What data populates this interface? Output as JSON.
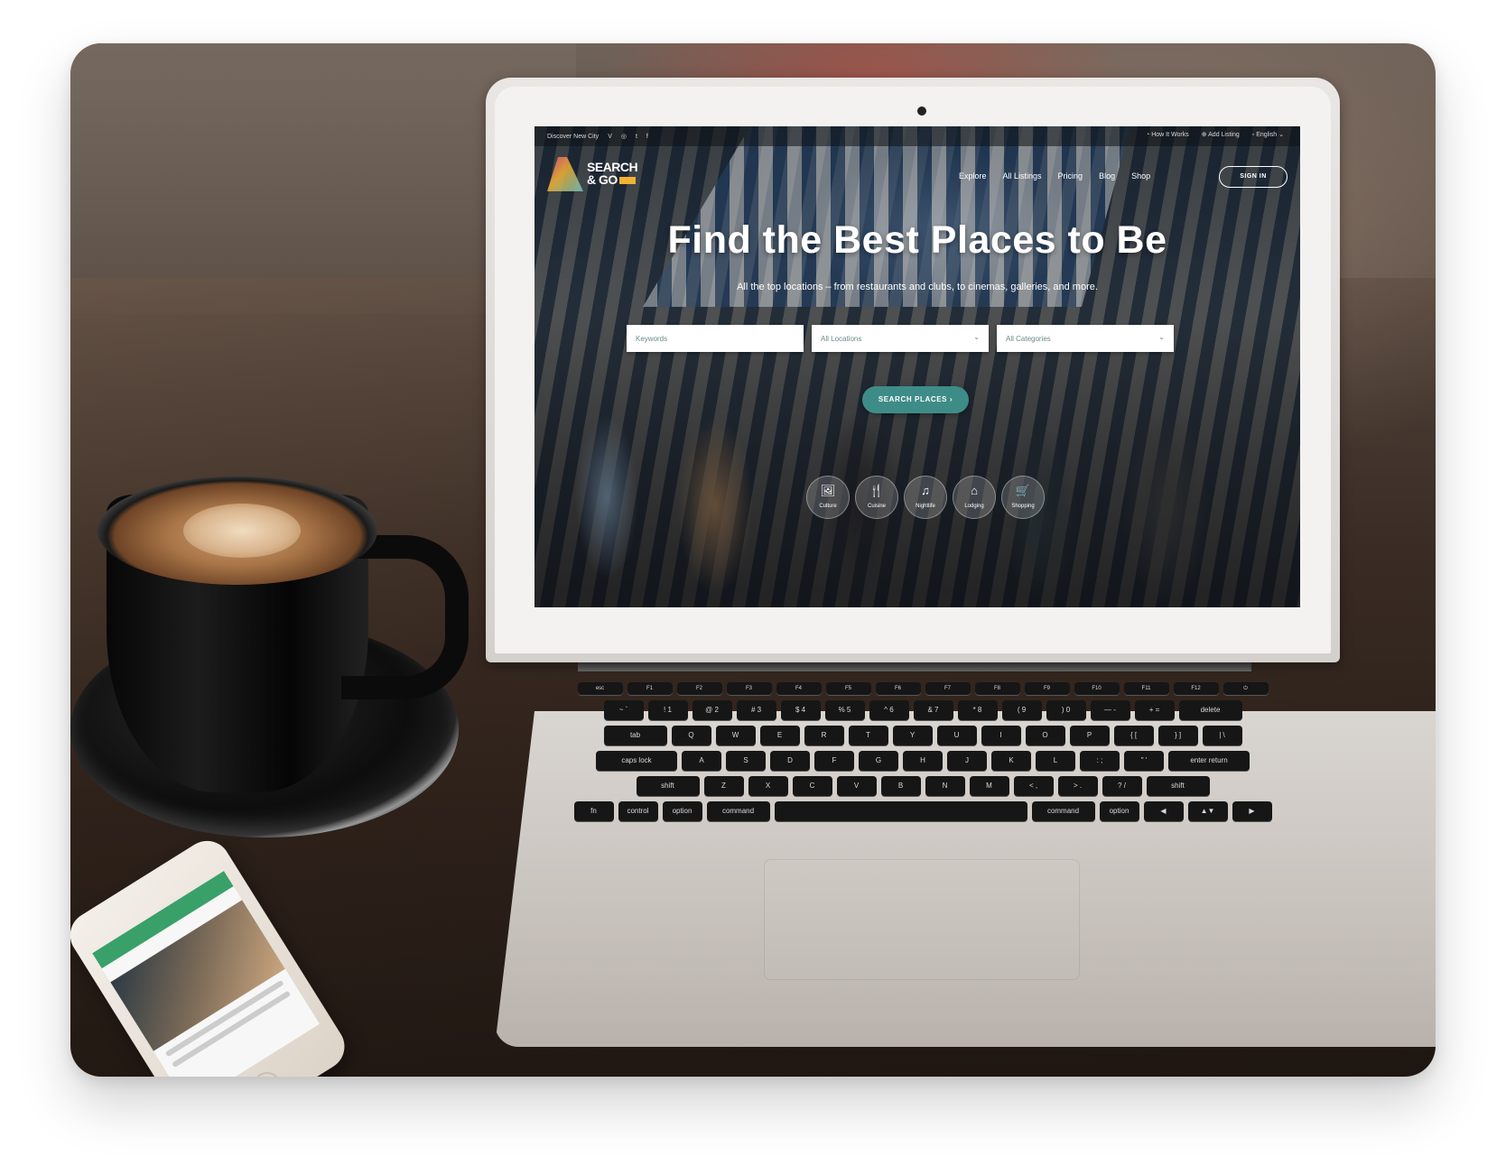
{
  "website": {
    "topbar": {
      "discover_label": "Discover New City",
      "social": [
        "V",
        "◎",
        "t",
        "f"
      ],
      "how_it_works": "How It Works",
      "add_listing": "Add Listing",
      "language": "English"
    },
    "logo": {
      "line1": "SEARCH",
      "line2": "& GO"
    },
    "nav": [
      "Explore",
      "All Listings",
      "Pricing",
      "Blog",
      "Shop"
    ],
    "signin_label": "SIGN IN",
    "hero": {
      "title": "Find the Best Places to Be",
      "subtitle": "All the top locations – from restaurants and clubs, to cinemas, galleries, and more."
    },
    "search": {
      "keywords_placeholder": "Keywords",
      "locations_value": "All Locations",
      "categories_value": "All Categories",
      "button_label": "SEARCH PLACES"
    },
    "categories": [
      {
        "label": "Culture",
        "icon": "🖼"
      },
      {
        "label": "Cuisine",
        "icon": "🍴"
      },
      {
        "label": "Nightlife",
        "icon": "♫"
      },
      {
        "label": "Lodging",
        "icon": "⌂"
      },
      {
        "label": "Shopping",
        "icon": "🛒"
      }
    ],
    "accent_color": "#3e8c88"
  },
  "keyboard": {
    "row0": [
      "esc",
      "F1",
      "F2",
      "F3",
      "F4",
      "F5",
      "F6",
      "F7",
      "F8",
      "F9",
      "F10",
      "F11",
      "F12",
      "⏻"
    ],
    "row1": [
      "~ `",
      "! 1",
      "@ 2",
      "# 3",
      "$ 4",
      "% 5",
      "^ 6",
      "& 7",
      "* 8",
      "( 9",
      ") 0",
      "— -",
      "+ =",
      "delete"
    ],
    "row2": [
      "tab",
      "Q",
      "W",
      "E",
      "R",
      "T",
      "Y",
      "U",
      "I",
      "O",
      "P",
      "{ [",
      "} ]",
      "| \\"
    ],
    "row3": [
      "caps lock",
      "A",
      "S",
      "D",
      "F",
      "G",
      "H",
      "J",
      "K",
      "L",
      ": ;",
      "\" '",
      "enter return"
    ],
    "row4": [
      "shift",
      "Z",
      "X",
      "C",
      "V",
      "B",
      "N",
      "M",
      "< ,",
      "> .",
      "? /",
      "shift"
    ],
    "row5": [
      "fn",
      "control",
      "option",
      "command",
      "",
      "command",
      "option",
      "◀",
      "▲▼",
      "▶"
    ]
  }
}
